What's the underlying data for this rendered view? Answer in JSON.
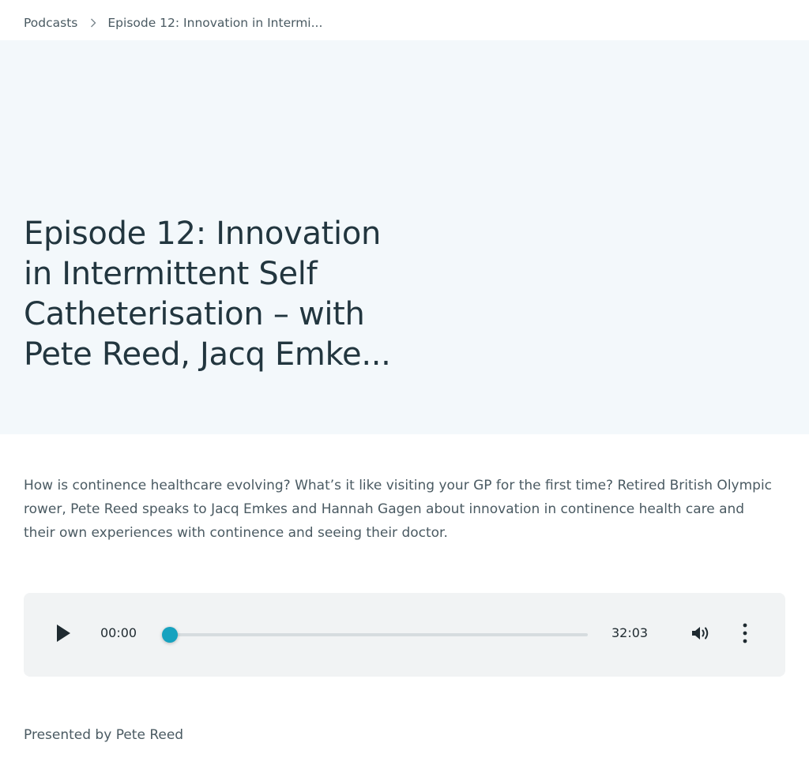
{
  "breadcrumb": {
    "root": "Podcasts",
    "current": "Episode 12: Innovation in Intermi..."
  },
  "episode": {
    "title": "Episode 12: Innovation in Intermittent Self Catheterisation – with Pete Reed, Jacq Emke...",
    "description": "How is continence healthcare evolving? What’s it like visiting your GP for the first time? Retired British Olympic rower, Pete Reed speaks to Jacq Emkes and Hannah Gagen about innovation in continence health care and their own experiences with continence and seeing their doctor.",
    "presenter": "Presented by Pete Reed"
  },
  "player": {
    "current_time": "00:00",
    "total_time": "32:03",
    "progress": 0,
    "icons": {
      "play": "play-icon",
      "volume": "volume-icon",
      "menu": "more-vertical-icon"
    },
    "accent_color": "#16a2bf"
  },
  "colors": {
    "hero_background": "#f3f8fb",
    "title_text": "#22363f",
    "body_text": "#4a5a62",
    "player_background": "#f1f3f4"
  }
}
